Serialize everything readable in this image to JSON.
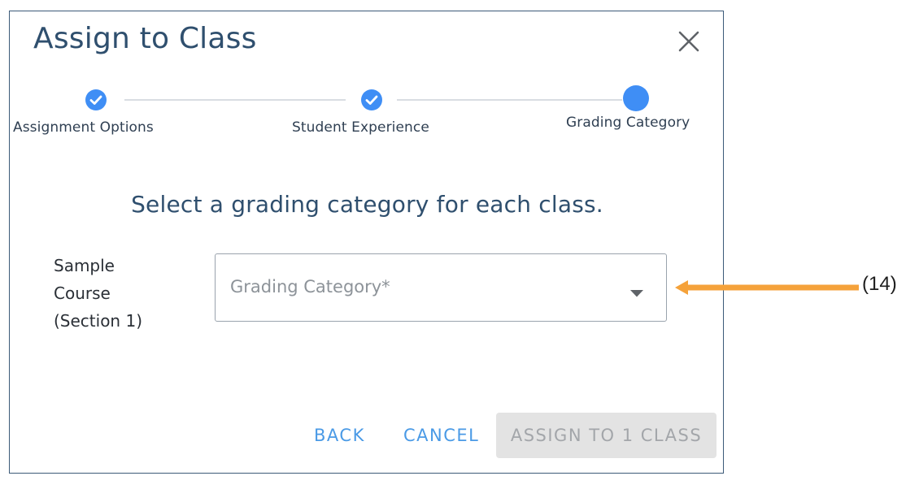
{
  "dialog": {
    "title": "Assign to Class",
    "close_icon": "close-icon"
  },
  "stepper": {
    "steps": [
      {
        "label": "Assignment Options",
        "state": "completed",
        "icon": "check-icon"
      },
      {
        "label": "Student Experience",
        "state": "completed",
        "icon": "check-icon"
      },
      {
        "label": "Grading Category",
        "state": "active"
      }
    ]
  },
  "main": {
    "instruction": "Select a grading category for each class.",
    "rows": [
      {
        "course_lines": [
          "Sample",
          "Course",
          "(Section 1)"
        ],
        "select_placeholder": "Grading Category*",
        "select_icon": "caret-down-icon"
      }
    ]
  },
  "footer": {
    "back_label": "BACK",
    "cancel_label": "CANCEL",
    "assign_label": "ASSIGN TO 1 CLASS",
    "assign_enabled": false
  },
  "annotation": {
    "callout_label": "(14)",
    "arrow_color": "#f5a23a"
  },
  "colors": {
    "accent": "#3f8ef5",
    "link": "#4a9ae6",
    "title": "#2f4f6e",
    "disabled_bg": "#e3e3e3",
    "disabled_text": "#a3a6aa"
  }
}
